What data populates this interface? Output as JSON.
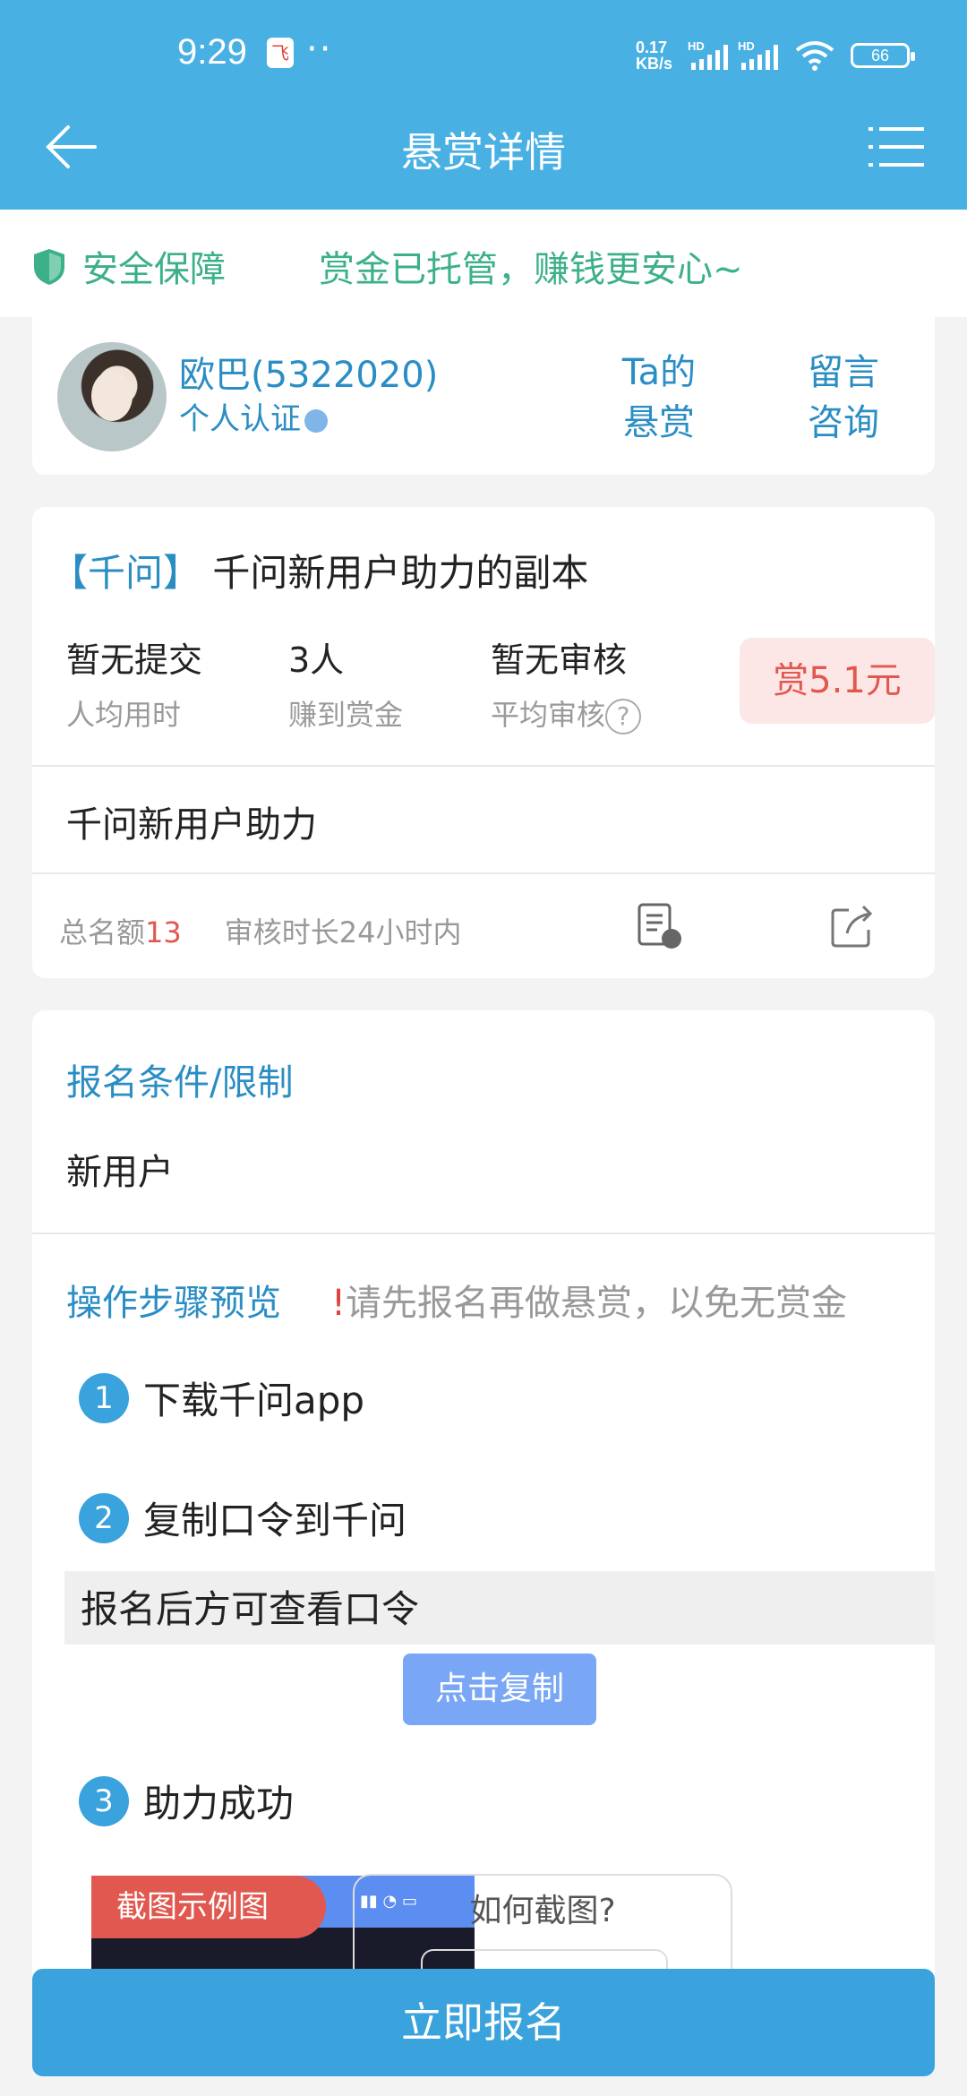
{
  "status_bar": {
    "time": "9:29",
    "notif_glyph": "飞",
    "dots": "··",
    "net_speed_value": "0.17",
    "net_speed_unit": "KB/s",
    "signal_label": "HD",
    "battery": "66"
  },
  "nav": {
    "title": "悬赏详情"
  },
  "secure": {
    "label": "安全保障",
    "message": "赏金已托管，赚钱更安心~"
  },
  "user": {
    "name": "欧巴(5322020)",
    "cert": "个人认证",
    "link_ta_1": "Ta的",
    "link_ta_2": "悬赏",
    "link_msg_1": "留言",
    "link_msg_2": "咨询"
  },
  "task": {
    "tag": "【千问】",
    "title": "千问新用户助力的副本",
    "stats": [
      {
        "value": "暂无提交",
        "label": "人均用时"
      },
      {
        "value": "3人",
        "label": "赚到赏金"
      },
      {
        "value": "暂无审核",
        "label": "平均审核"
      }
    ],
    "reward": "赏5.1元",
    "subtitle": "千问新用户助力",
    "quota_label": "总名额",
    "quota_num": "13",
    "review_time": "审核时长24小时内"
  },
  "conditions": {
    "heading": "报名条件/限制",
    "text": "新用户",
    "steps_heading": "操作步骤预览",
    "warn_bang": "!",
    "warn_text": "请先报名再做悬赏，以免无赏金",
    "steps": [
      {
        "num": "1",
        "label": "下载千问app"
      },
      {
        "num": "2",
        "label": "复制口令到千问"
      },
      {
        "num": "3",
        "label": "助力成功"
      }
    ],
    "code_placeholder": "报名后方可查看口令",
    "copy_button": "点击复制",
    "example_label": "截图示例图",
    "howto_title": "如何截图?"
  },
  "signup_button": "立即报名",
  "colors": {
    "primary": "#49b0e3",
    "accent_green": "#3cb088",
    "link_blue": "#2a8dc4",
    "reward_red": "#e0584f",
    "button_blue": "#3aa2dc"
  }
}
